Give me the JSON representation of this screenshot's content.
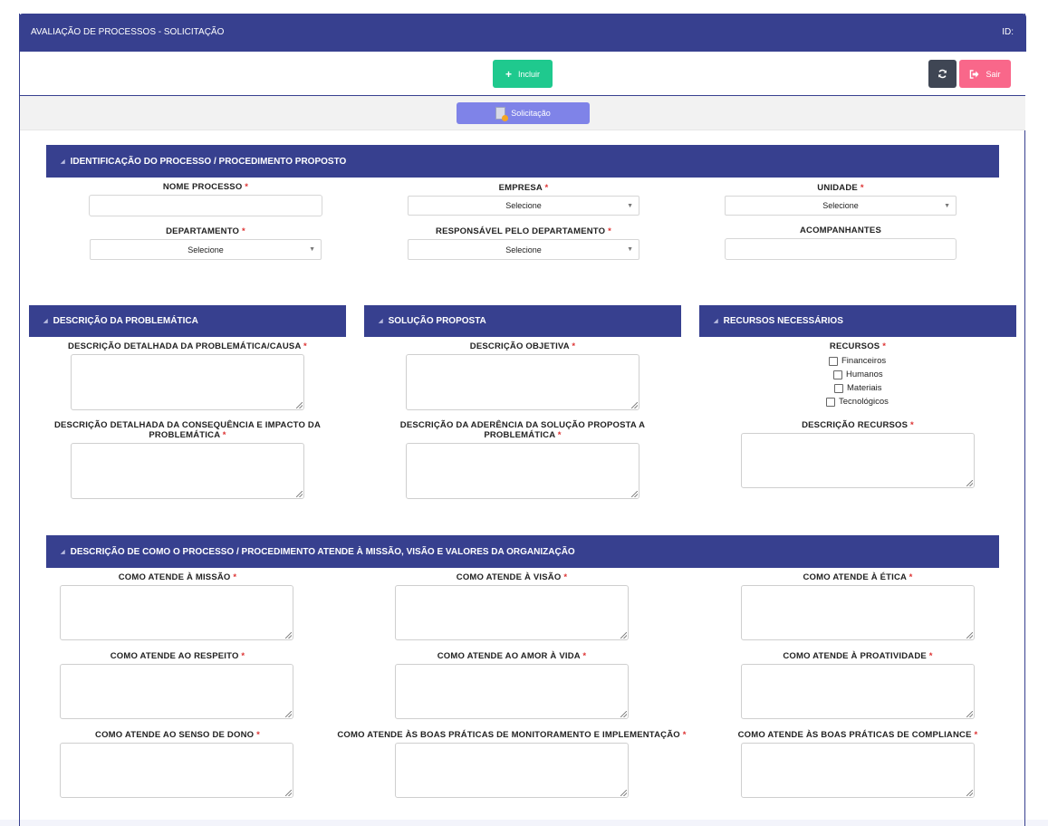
{
  "window": {
    "title": "AVALIAÇÃO DE PROCESSOS - SOLICITAÇÃO",
    "id_label": "ID:"
  },
  "toolbar": {
    "incluir_label": "Incluir",
    "sair_label": "Sair"
  },
  "tab": {
    "label": "Solicitação"
  },
  "colors": {
    "header": "#37408f",
    "incluir": "#1fc98e",
    "sair": "#f9678a",
    "refresh": "#3f4654",
    "tab": "#7f83e8",
    "required": "#dd3333"
  },
  "identificacao": {
    "title": "IDENTIFICAÇÃO DO PROCESSO / PROCEDIMENTO PROPOSTO",
    "nome_processo": "NOME PROCESSO",
    "empresa": "EMPRESA",
    "unidade": "UNIDADE",
    "departamento": "DEPARTAMENTO",
    "responsavel": "RESPONSÁVEL PELO DEPARTAMENTO",
    "acompanhantes": "ACOMPANHANTES",
    "select_placeholder": "Selecione",
    "required_mark": "*"
  },
  "problematica": {
    "title": "DESCRIÇÃO DA PROBLEMÁTICA",
    "detalhada": "DESCRIÇÃO DETALHADA DA PROBLEMÁTICA/CAUSA",
    "consequencia_line1": "DESCRIÇÃO DETALHADA DA CONSEQUÊNCIA E IMPACTO DA",
    "consequencia_line2": "PROBLEMÁTICA"
  },
  "solucao": {
    "title": "SOLUÇÃO PROPOSTA",
    "objetiva": "DESCRIÇÃO OBJETIVA",
    "aderencia_line1": "DESCRIÇÃO DA ADERÊNCIA DA SOLUÇÃO PROPOSTA A",
    "aderencia_line2": "PROBLEMÁTICA"
  },
  "recursos": {
    "title": "RECURSOS NECESSÁRIOS",
    "label": "RECURSOS",
    "options": [
      "Financeiros",
      "Humanos",
      "Materiais",
      "Tecnológicos"
    ],
    "descricao": "DESCRIÇÃO RECURSOS"
  },
  "missao": {
    "title": "DESCRIÇÃO DE COMO O PROCESSO / PROCEDIMENTO ATENDE À MISSÃO, VISÃO E VALORES DA ORGANIZAÇÃO",
    "missao": "COMO ATENDE À MISSÃO",
    "visao": "COMO ATENDE À VISÃO",
    "etica": "COMO ATENDE À ÉTICA",
    "respeito": "COMO ATENDE AO RESPEITO",
    "amor": "COMO ATENDE AO AMOR À VIDA",
    "proatividade": "COMO ATENDE À PROATIVIDADE",
    "dono": "COMO ATENDE AO SENSO DE DONO",
    "monitoramento": "COMO ATENDE ÀS BOAS PRÁTICAS DE MONITORAMENTO E IMPLEMENTAÇÃO",
    "compliance": "COMO ATENDE ÀS BOAS PRÁTICAS DE COMPLIANCE"
  }
}
